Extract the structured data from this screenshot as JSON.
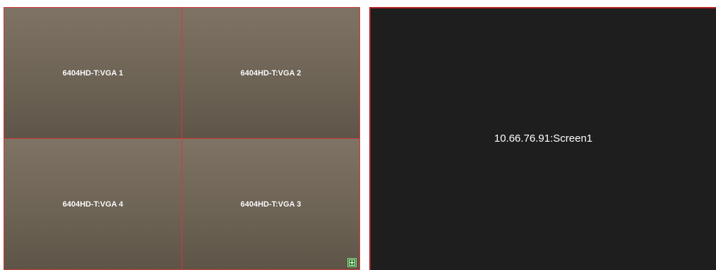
{
  "video_wall": {
    "cells": [
      {
        "label": "6404HD-T:VGA 1"
      },
      {
        "label": "6404HD-T:VGA 2"
      },
      {
        "label": "6404HD-T:VGA 4"
      },
      {
        "label": "6404HD-T:VGA 3"
      }
    ],
    "snap_icon": "grid-snap-icon",
    "border_color": "#d23a3a",
    "cell_color": "#6e6456"
  },
  "screen_panel": {
    "label": "10.66.76.91:Screen1",
    "background": "#1e1e1e",
    "border_color": "#b22222"
  }
}
